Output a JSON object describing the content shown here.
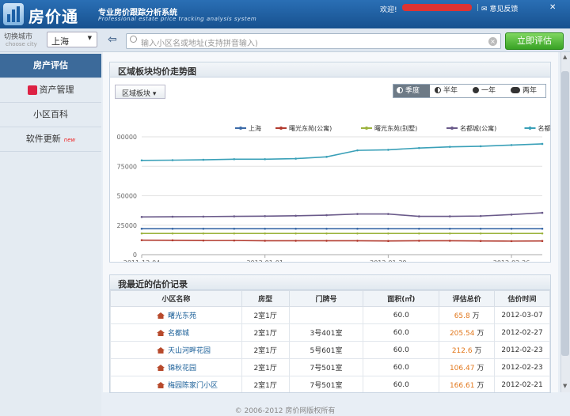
{
  "app": {
    "logo_text": "房价通",
    "subtitle": "专业房价跟踪分析系统",
    "subtitle_en": "Professional estate price tracking analysis system",
    "welcome": "欢迎!",
    "feedback": "意见反馈",
    "close": "✕"
  },
  "city": {
    "label": "切换城市",
    "label_en": "choose city",
    "selected": "上海"
  },
  "search": {
    "placeholder": "输入小区名或地址(支持拼音输入)",
    "button": "立即评估"
  },
  "sidebar": {
    "items": [
      {
        "label": "房产评估",
        "active": true
      },
      {
        "label": "资产管理",
        "icon": "asset-icon"
      },
      {
        "label": "小区百科"
      },
      {
        "label": "软件更新",
        "badge": "new"
      }
    ]
  },
  "trend_panel": {
    "title": "区域板块均价走势图",
    "region_button": "区域板块",
    "periods": [
      {
        "label": "季度",
        "active": true
      },
      {
        "label": "半年"
      },
      {
        "label": "一年"
      },
      {
        "label": "两年"
      }
    ]
  },
  "chart_data": {
    "type": "line",
    "x": [
      "2011-12-04",
      "2011-12-11",
      "2011-12-18",
      "2011-12-25",
      "2012-01-01",
      "2012-01-08",
      "2012-01-15",
      "2012-01-22",
      "2012-01-29",
      "2012-02-05",
      "2012-02-12",
      "2012-02-19",
      "2012-02-26",
      "2012-03-04"
    ],
    "x_tick_labels": [
      "2011-12-04",
      "2012-01-01",
      "2012-01-29",
      "2012-02-26"
    ],
    "y_tick_labels": [
      "0",
      "25000",
      "50000",
      "75000",
      "00000"
    ],
    "ylim": [
      0,
      100000
    ],
    "grid": true,
    "legend_position": "top",
    "series": [
      {
        "name": "上海",
        "color": "#3a6aa8",
        "values": [
          22000,
          22000,
          22000,
          22000,
          22000,
          22000,
          22000,
          22000,
          22000,
          22000,
          22000,
          22000,
          22000,
          22000
        ]
      },
      {
        "name": "曙光东苑(公寓)",
        "color": "#b23a2e",
        "values": [
          12300,
          12200,
          12000,
          12000,
          11800,
          11800,
          11800,
          11800,
          11600,
          11800,
          11800,
          11600,
          11500,
          11600
        ]
      },
      {
        "name": "曙光东苑(别墅)",
        "color": "#9cb33e",
        "values": [
          18000,
          18000,
          18000,
          18000,
          18000,
          18000,
          18000,
          18000,
          18000,
          18000,
          18000,
          18000,
          18000,
          18000
        ]
      },
      {
        "name": "名都城(公寓)",
        "color": "#6a5a8a",
        "values": [
          32000,
          32200,
          32300,
          32500,
          32700,
          33000,
          33500,
          34500,
          34500,
          32500,
          32500,
          32800,
          34000,
          35500
        ]
      },
      {
        "name": "名都城(别墅)",
        "color": "#3aa0b8",
        "values": [
          80000,
          80200,
          80500,
          81000,
          81000,
          81500,
          83000,
          88500,
          89000,
          90500,
          91500,
          92000,
          93000,
          94000
        ]
      }
    ]
  },
  "history_panel": {
    "title": "我最近的估价记录",
    "columns": [
      "小区名称",
      "房型",
      "门牌号",
      "面积(㎡)",
      "评估总价",
      "估价时间"
    ],
    "rows": [
      {
        "name": "曙光东苑",
        "layout": "2室1厅",
        "unit": "",
        "area": "60.0",
        "price": "65.8",
        "unit_label": "万",
        "date": "2012-03-07"
      },
      {
        "name": "名都城",
        "layout": "2室1厅",
        "unit": "3号401室",
        "area": "60.0",
        "price": "205.54",
        "unit_label": "万",
        "date": "2012-02-27"
      },
      {
        "name": "天山河畔花园",
        "layout": "2室1厅",
        "unit": "5号601室",
        "area": "60.0",
        "price": "212.6",
        "unit_label": "万",
        "date": "2012-02-23"
      },
      {
        "name": "锦秋花园",
        "layout": "2室1厅",
        "unit": "7号501室",
        "area": "60.0",
        "price": "106.47",
        "unit_label": "万",
        "date": "2012-02-23"
      },
      {
        "name": "梅园陈家门小区",
        "layout": "2室1厅",
        "unit": "7号501室",
        "area": "60.0",
        "price": "166.61",
        "unit_label": "万",
        "date": "2012-02-21"
      }
    ]
  },
  "footer": "© 2006-2012 房价网版权所有"
}
